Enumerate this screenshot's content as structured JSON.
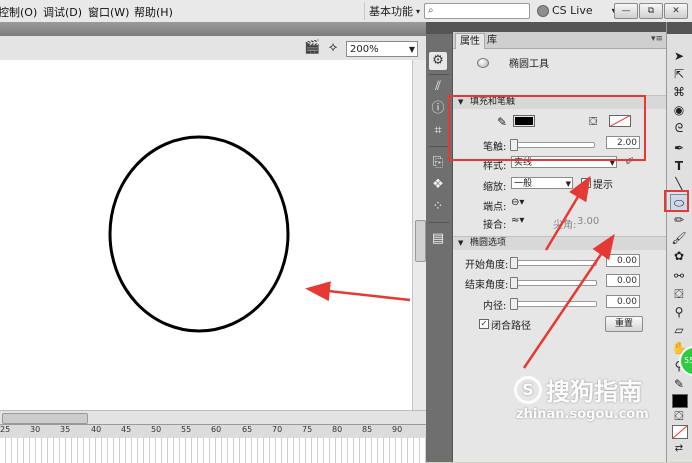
{
  "menu": {
    "items": [
      "控制(O)",
      "调试(D)",
      "窗口(W)",
      "帮助(H)"
    ],
    "workspace": "基本功能",
    "workspace_arrow": "▾",
    "cs_live": "CS Live",
    "window_buttons": [
      "—",
      "⧉",
      "✕"
    ]
  },
  "stage_toolbar": {
    "zoom": "200%"
  },
  "timeline": {
    "ticks": [
      "25",
      "30",
      "35",
      "40",
      "45",
      "50",
      "55",
      "60",
      "65",
      "70",
      "75",
      "80",
      "85",
      "90"
    ]
  },
  "panel": {
    "tabs": [
      "属性",
      "库"
    ],
    "tool_name": "椭圆工具",
    "fill_stroke": {
      "header": "填充和笔触",
      "stroke_color": "#000000",
      "fill_none": true,
      "stroke_label": "笔触:",
      "stroke_value": "2.00",
      "style_label": "样式:",
      "style_value": "实线",
      "scale_label": "缩放:",
      "scale_value": "一般",
      "hint_label": "提示",
      "cap_label": "端点:",
      "join_label": "接合:",
      "miter_label": "尖角:",
      "miter_value": "3.00"
    },
    "oval_options": {
      "header": "椭圆选项",
      "start_label": "开始角度:",
      "start_value": "0.00",
      "end_label": "结束角度:",
      "end_value": "0.00",
      "inner_label": "内径:",
      "inner_value": "0.00",
      "close_path_label": "闭合路径",
      "reset_label": "重置"
    }
  },
  "watermark": {
    "brand": "搜狗指南",
    "url": "zhinan.sogou.com"
  },
  "colors": {
    "annotation_red": "#e53935"
  }
}
